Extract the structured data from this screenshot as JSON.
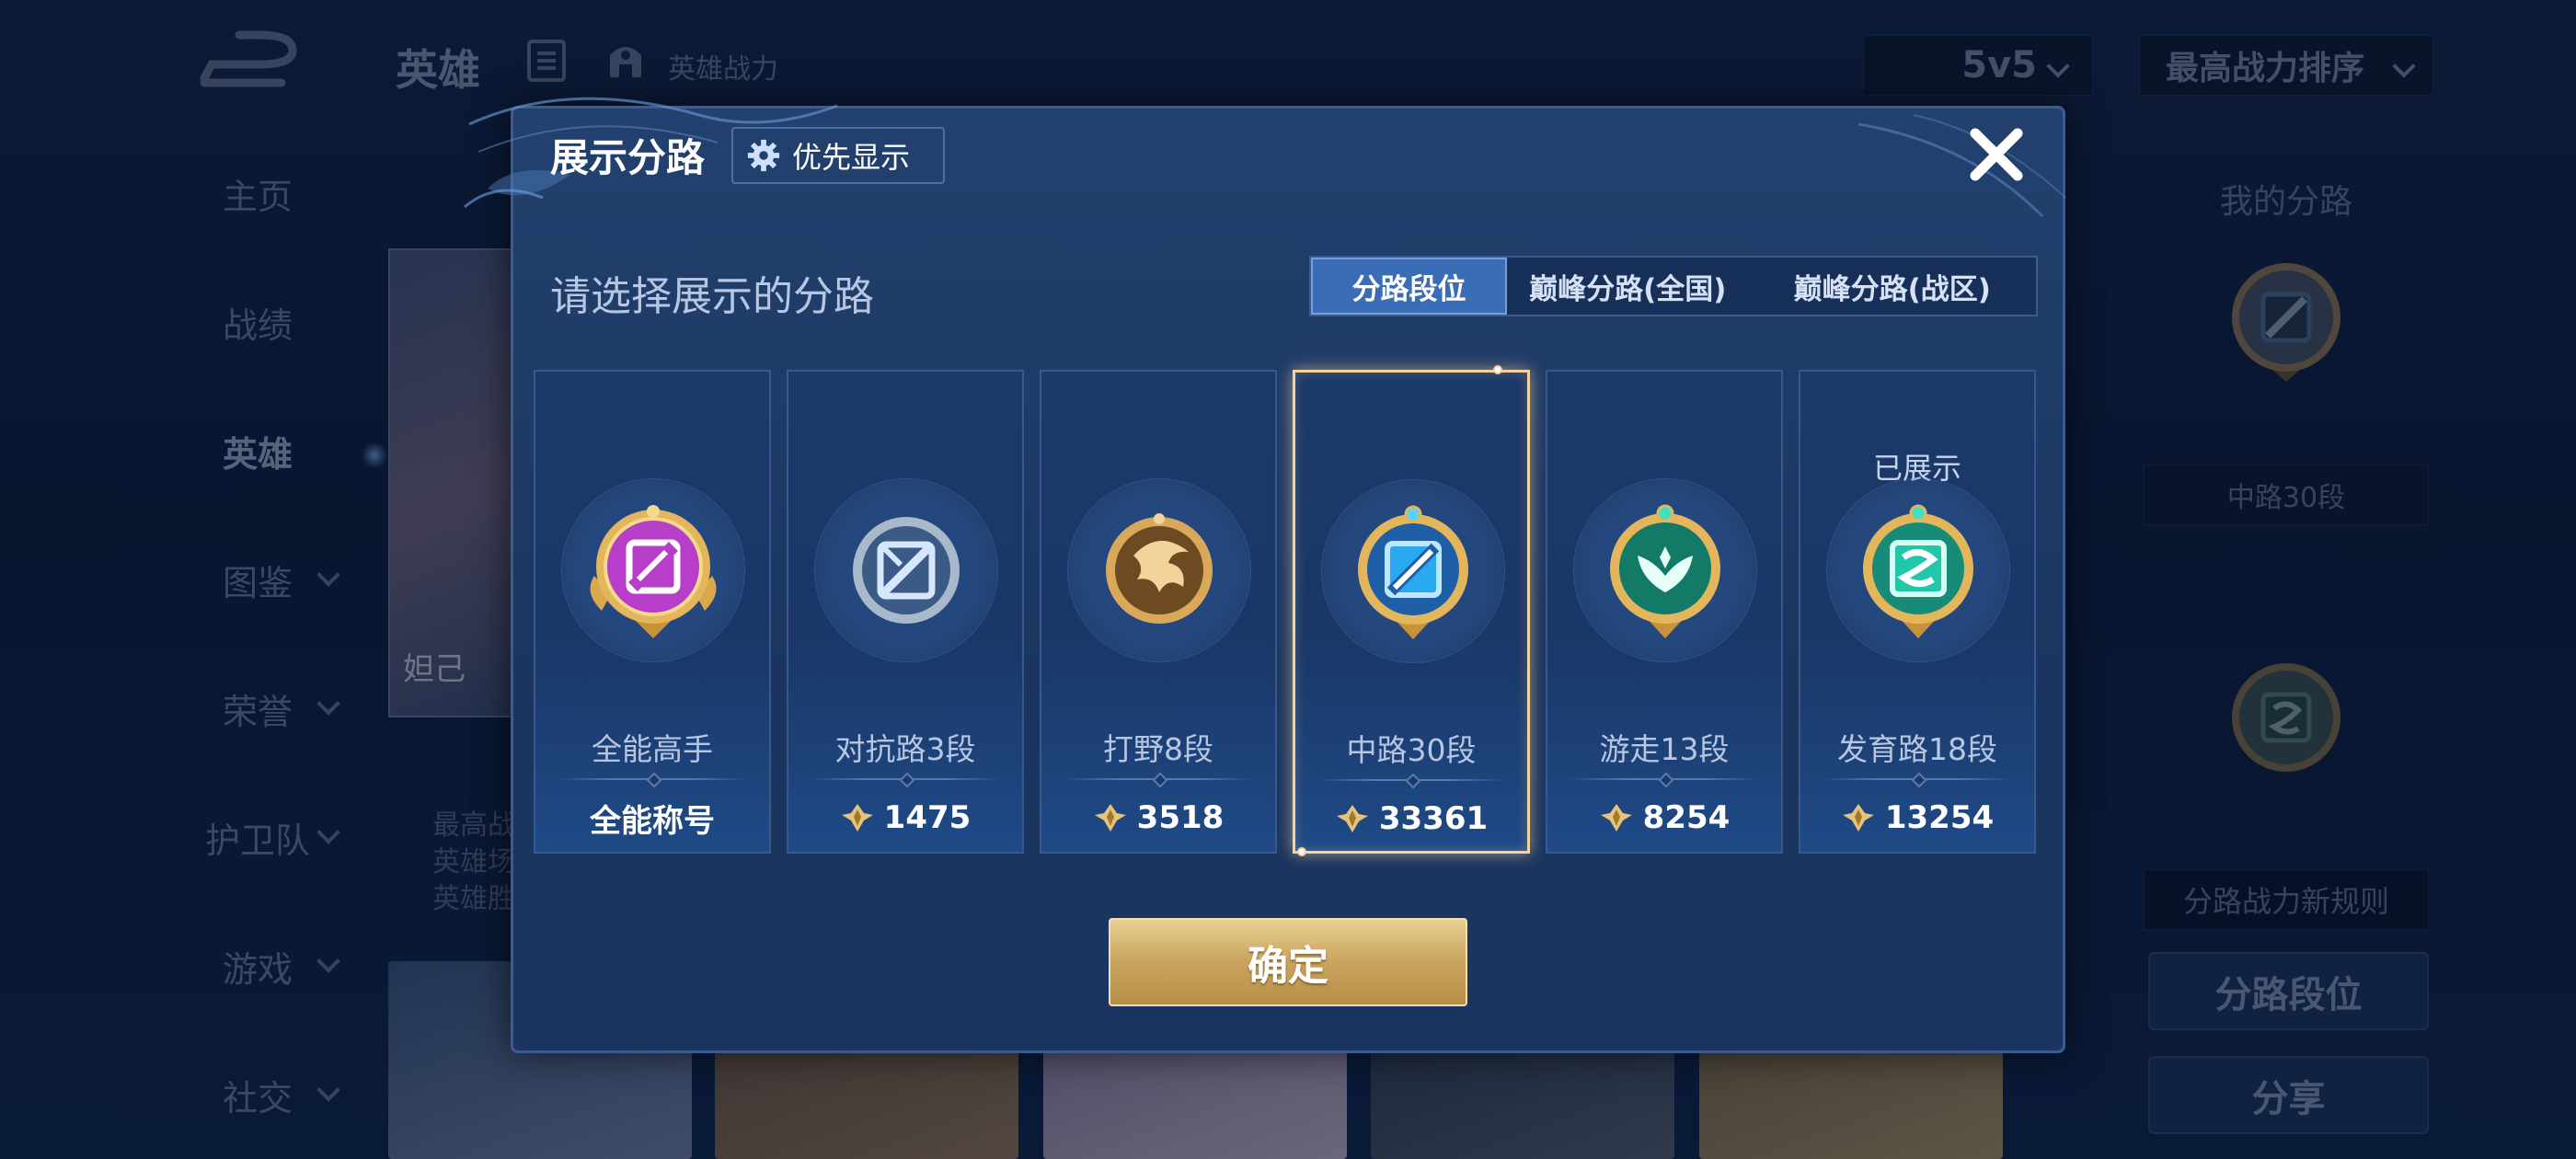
{
  "header": {
    "title": "英雄",
    "power_label": "英雄战力",
    "mode_select": "5v5",
    "sort_select": "最高战力排序"
  },
  "sidebar": {
    "items": [
      {
        "label": "主页"
      },
      {
        "label": "战绩"
      },
      {
        "label": "英雄",
        "active": true
      },
      {
        "label": "图鉴",
        "expandable": true
      },
      {
        "label": "荣誉",
        "expandable": true
      },
      {
        "label": "护卫队",
        "expandable": true
      },
      {
        "label": "游戏",
        "expandable": true
      },
      {
        "label": "社交",
        "expandable": true
      }
    ]
  },
  "background_hero": {
    "name": "妲己",
    "stats": [
      "最高战",
      "英雄场",
      "英雄胜"
    ]
  },
  "right_panel": {
    "title": "我的分路",
    "current_rank": "中路30段",
    "new_rules": "分路战力新规则",
    "rank_button": "分路段位",
    "share_button": "分享"
  },
  "modal": {
    "title": "展示分路",
    "priority_button": "优先显示",
    "subtitle": "请选择展示的分路",
    "tabs": [
      {
        "label": "分路段位",
        "selected": true
      },
      {
        "label": "巅峰分路(全国)"
      },
      {
        "label": "巅峰分路(战区)"
      }
    ],
    "cards": [
      {
        "rank": "全能高手",
        "value": "全能称号",
        "icon": "all-round-emblem-icon",
        "color": "#b63ec8"
      },
      {
        "rank": "对抗路3段",
        "value": "1475",
        "icon": "clash-lane-emblem-icon",
        "color": "#9cc0e6"
      },
      {
        "rank": "打野8段",
        "value": "3518",
        "icon": "jungle-emblem-icon",
        "color": "#b07a3c"
      },
      {
        "rank": "中路30段",
        "value": "33361",
        "icon": "mid-lane-emblem-icon",
        "color": "#2aa8f0",
        "selected": true
      },
      {
        "rank": "游走13段",
        "value": "8254",
        "icon": "roam-emblem-icon",
        "color": "#1fa88a"
      },
      {
        "rank": "发育路18段",
        "value": "13254",
        "icon": "farm-lane-emblem-icon",
        "color": "#22c6a8",
        "status": "已展示"
      }
    ],
    "confirm_button": "确定"
  },
  "colors": {
    "accent_gold": "#f5d49b",
    "tab_selected": "#3a6db5",
    "modal_bg": "#23416f"
  }
}
